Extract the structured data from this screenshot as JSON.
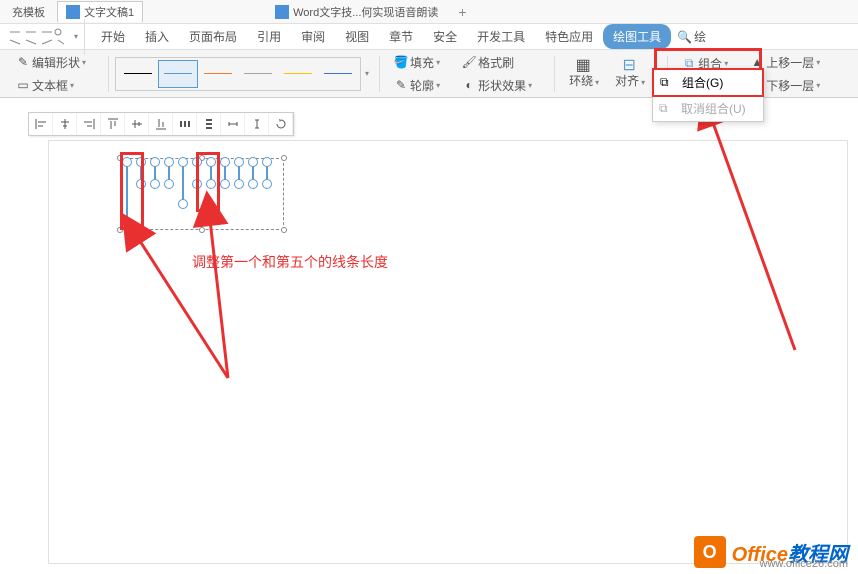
{
  "titlebar": {
    "tab1": "充模板",
    "tab2": "文字文稿1",
    "tab3": "Word文字技...何实现语音朗读"
  },
  "ribbon_tabs": {
    "start": "开始",
    "insert": "插入",
    "page_layout": "页面布局",
    "reference": "引用",
    "review": "审阅",
    "view": "视图",
    "section": "章节",
    "security": "安全",
    "dev_tools": "开发工具",
    "special": "特色应用",
    "drawing_tools": "绘图工具",
    "search": "绘"
  },
  "ribbon": {
    "edit_shape": "编辑形状",
    "text_box": "文本框",
    "fill": "填充",
    "outline": "轮廓",
    "format_painter": "格式刷",
    "shape_effects": "形状效果",
    "wrap": "环绕",
    "align": "对齐",
    "group": "组合",
    "bring_forward": "上移一层",
    "send_backward": "下移一层"
  },
  "dropdown": {
    "group": "组合(G)",
    "ungroup": "取消组合(U)"
  },
  "annotation": "调整第一个和第五个的线条长度",
  "watermark": {
    "brand1": "Office",
    "brand2": "教程网",
    "url": "www.office26.com"
  }
}
